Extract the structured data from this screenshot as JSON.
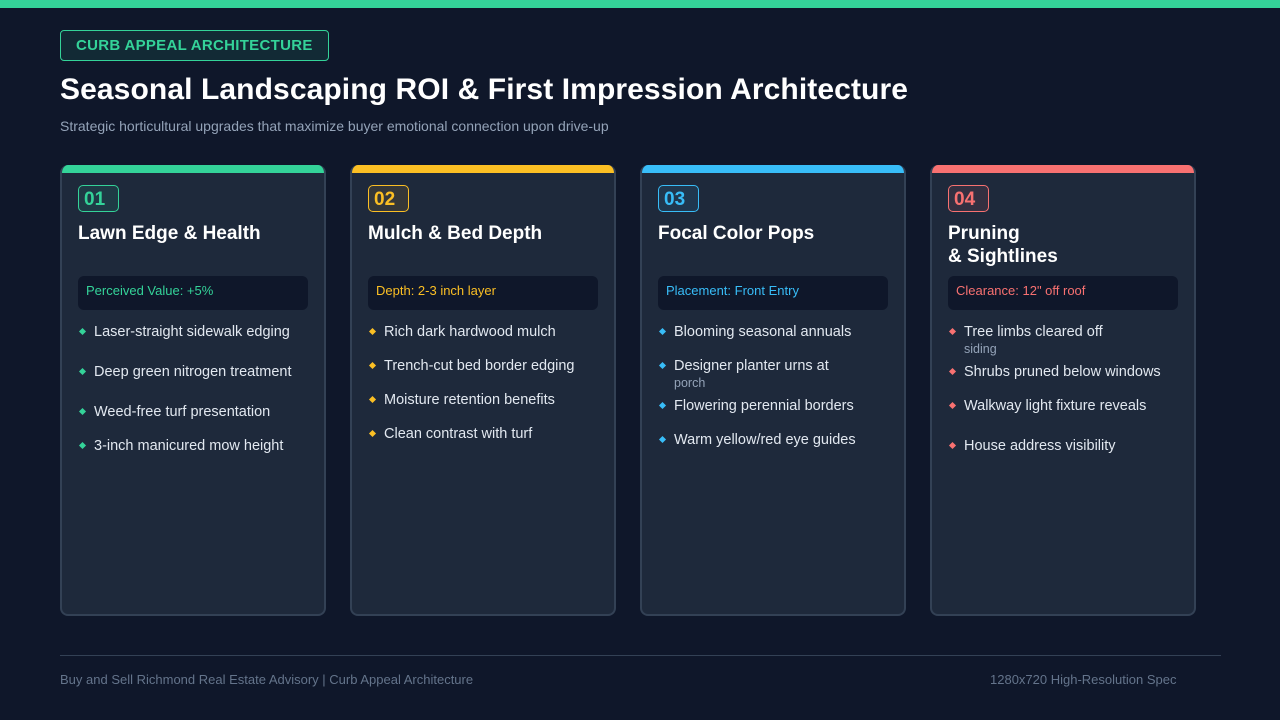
{
  "header": {
    "tag": "CURB APPEAL ARCHITECTURE",
    "title": "Seasonal Landscaping ROI & First Impression Architecture",
    "subtitle": "Strategic horticultural upgrades that maximize buyer emotional connection upon drive-up",
    "accent_color": "#34d399"
  },
  "cards": [
    {
      "number": "01",
      "title": "Lawn Edge & Health",
      "title_line2": "",
      "badge": "Perceived Value: +5%",
      "color": "#34d399",
      "items": [
        {
          "text": "Laser-straight sidewalk edging",
          "sub": ""
        },
        {
          "text": "Deep green nitrogen treatment",
          "sub": ""
        },
        {
          "text": "Weed-free turf presentation",
          "sub": ""
        },
        {
          "text": "3-inch manicured mow height",
          "sub": ""
        }
      ]
    },
    {
      "number": "02",
      "title": "Mulch & Bed Depth",
      "title_line2": "",
      "badge": "Depth: 2-3 inch layer",
      "color": "#fbbf24",
      "items": [
        {
          "text": "Rich dark hardwood mulch",
          "sub": ""
        },
        {
          "text": "Trench-cut bed border edging",
          "sub": ""
        },
        {
          "text": "Moisture retention benefits",
          "sub": ""
        },
        {
          "text": "Clean contrast with turf",
          "sub": ""
        }
      ]
    },
    {
      "number": "03",
      "title": "Focal Color Pops",
      "title_line2": "",
      "badge": "Placement: Front Entry",
      "color": "#38bdf8",
      "items": [
        {
          "text": "Blooming seasonal annuals",
          "sub": ""
        },
        {
          "text": "Designer planter urns at",
          "sub": "porch"
        },
        {
          "text": "Flowering perennial borders",
          "sub": ""
        },
        {
          "text": "Warm yellow/red eye guides",
          "sub": ""
        }
      ]
    },
    {
      "number": "04",
      "title": "Pruning",
      "title_line2": "& Sightlines",
      "badge": "Clearance: 12\" off roof",
      "color": "#f87171",
      "items": [
        {
          "text": "Tree limbs cleared off",
          "sub": "siding"
        },
        {
          "text": "Shrubs pruned below windows",
          "sub": ""
        },
        {
          "text": "Walkway light fixture reveals",
          "sub": ""
        },
        {
          "text": "House address visibility",
          "sub": ""
        }
      ]
    }
  ],
  "footer": {
    "left": "Buy and Sell Richmond Real Estate Advisory | Curb Appeal Architecture",
    "right": "1280x720 High-Resolution Spec"
  }
}
